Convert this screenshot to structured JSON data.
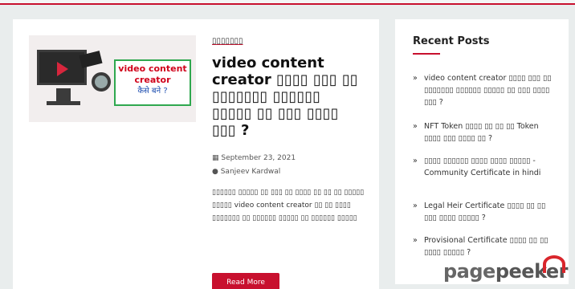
{
  "article": {
    "thumb": {
      "line1": "video content",
      "line2": "creator",
      "line3": "कैसे बने ?"
    },
    "category": "▯▯▯▯▯▯▯",
    "title": "video content creator ▯▯▯▯ ▯▯▯ ▯▯ ▯▯▯▯▯▯▯ ▯▯▯▯▯▯ ▯▯▯▯▯ ▯▯ ▯▯▯ ▯▯▯▯ ▯▯▯ ?",
    "date": "September 23, 2021",
    "author": "Sanjeev Kardwal",
    "excerpt": "▯▯▯▯▯▯ ▯▯▯▯▯ ▯▯ ▯▯▯ ▯▯ ▯▯▯▯ ▯▯ ▯▯ ▯▯ ▯▯▯▯▯ ▯▯▯▯▯ video content creator ▯▯ ▯▯ ▯▯▯▯ ▯▯▯▯▯▯▯ ▯▯ ▯▯▯▯▯▯ ▯▯▯▯▯ ▯▯ ▯▯▯▯▯▯ ▯▯▯▯▯",
    "read_more": "Read More"
  },
  "sidebar": {
    "heading": "Recent Posts",
    "arrow": "»",
    "posts": [
      "video content creator ▯▯▯▯ ▯▯▯ ▯▯ ▯▯▯▯▯▯▯ ▯▯▯▯▯▯ ▯▯▯▯▯ ▯▯ ▯▯▯ ▯▯▯▯ ▯▯▯ ?",
      "NFT Token ▯▯▯▯ ▯▯ ▯▯ ▯▯ Token ▯▯▯▯ ▯▯▯ ▯▯▯▯ ▯▯ ?",
      "▯▯▯▯ ▯▯▯▯▯▯ ▯▯▯▯ ▯▯▯▯ ▯▯▯▯▯ -Community Certificate in hindi",
      "Legal Heir Certificate ▯▯▯▯ ▯▯ ▯▯ ▯▯▯ ▯▯▯▯ ▯▯▯▯▯ ?",
      "Provisional Certificate ▯▯▯▯ ▯▯ ▯▯ ▯▯▯▯ ▯▯▯▯▯ ?"
    ]
  },
  "watermark": {
    "part1": "page",
    "part2": "peeker"
  }
}
